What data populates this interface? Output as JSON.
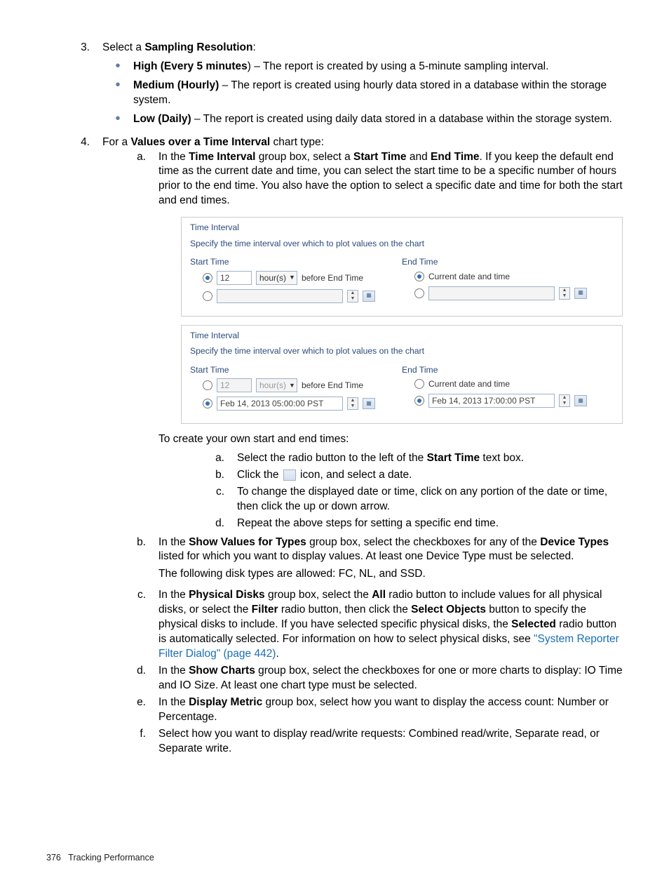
{
  "step3": {
    "num": "3.",
    "lead": "Select a ",
    "bold": "Sampling Resolution",
    "tail": ":",
    "bullets": [
      {
        "b": "High (Every 5 minutes",
        "t": ") – The report is created by using a 5-minute sampling interval."
      },
      {
        "b": "Medium (Hourly)",
        "t": " – The report is created using hourly data stored in a database within the storage system."
      },
      {
        "b": "Low (Daily)",
        "t": " – The report is created using daily data stored in a database within the storage system."
      }
    ]
  },
  "step4": {
    "num": "4.",
    "lead": "For a ",
    "bold": "Values over a Time Interval",
    "tail": " chart type:",
    "a": {
      "letter": "a.",
      "pre": "In the ",
      "b1": "Time Interval",
      "mid1": " group box, select a ",
      "b2": "Start Time",
      "mid2": " and ",
      "b3": "End Time",
      "post": ". If you keep the default end time as the current date and time, you can select the start time to be a specific number of hours prior to the end time. You also have the option to select a specific date and time for both the start and end times."
    },
    "fig1": {
      "title": "Time Interval",
      "sub": "Specify the time interval over which to plot values on the chart",
      "start": "Start Time",
      "end": "End Time",
      "val12": "12",
      "hours": "hour(s)",
      "before": "before End Time",
      "curr": "Current date and time"
    },
    "fig2": {
      "title": "Time Interval",
      "sub": "Specify the time interval over which to plot values on the chart",
      "start": "Start Time",
      "end": "End Time",
      "val12": "12",
      "hours": "hour(s)",
      "before": "before End Time",
      "curr": "Current date and time",
      "d1": "Feb 14, 2013 05:00:00 PST",
      "d2": "Feb 14, 2013 17:00:00 PST"
    },
    "ownintro": "To create your own start and end times:",
    "own": [
      {
        "l": "a.",
        "pre": "Select the radio button to the left of the ",
        "b": "Start Time",
        "post": " text box."
      },
      {
        "l": "b.",
        "pre": "Click the ",
        "icon": true,
        "post": " icon, and select a date."
      },
      {
        "l": "c.",
        "text": "To change the displayed date or time, click on any portion of the date or time, then click the up or down arrow."
      },
      {
        "l": "d.",
        "text": "Repeat the above steps for setting a specific end time."
      }
    ],
    "b": {
      "letter": "b.",
      "pre": "In the ",
      "b1": "Show Values for Types",
      "mid": " group box, select the checkboxes for any of the ",
      "b2": "Device Types",
      "post": " listed for which you want to display values. At least one Device Type must be selected.",
      "extra": "The following disk types are allowed: FC, NL, and SSD."
    },
    "c": {
      "letter": "c.",
      "pre": "In the ",
      "b1": "Physical Disks",
      "m1": " group box, select the ",
      "b2": "All",
      "m2": " radio button to include values for all physical disks, or select the ",
      "b3": "Filter",
      "m3": " radio button, then click the ",
      "b4": "Select Objects",
      "m4": "  button to specify the physical disks to include. If you have selected specific physical disks, the ",
      "b5": "Selected",
      "m5": " radio button is automatically selected. For information on how to select physical disks, see ",
      "link": "\"System Reporter Filter Dialog\" (page 442)",
      "period": "."
    },
    "d": {
      "letter": "d.",
      "pre": "In the ",
      "b1": "Show Charts",
      "post": " group box, select the checkboxes for one or more charts to display: IO Time and IO Size. At least one chart type must be selected."
    },
    "e": {
      "letter": "e.",
      "pre": "In the ",
      "b1": "Display Metric",
      "post": " group box, select how you want to display the access count: Number or Percentage."
    },
    "f": {
      "letter": "f.",
      "text": "Select how you want to display read/write requests: Combined read/write, Separate read, or Separate write."
    }
  },
  "footer": {
    "page": "376",
    "title": "Tracking Performance"
  }
}
